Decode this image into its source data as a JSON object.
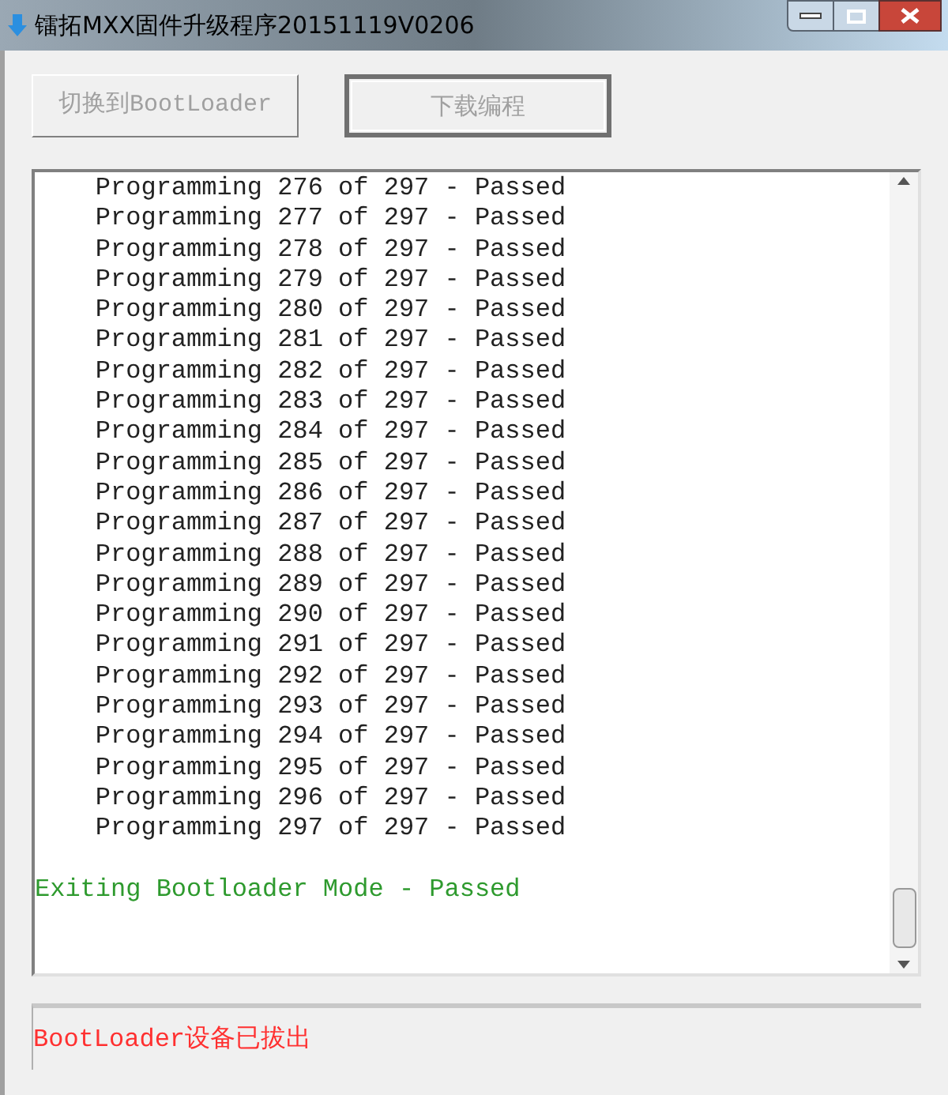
{
  "window": {
    "title": "镭拓MXX固件升级程序20151119V0206"
  },
  "buttons": [
    {
      "label": "切换到BootLoader",
      "disabled": true,
      "default": false
    },
    {
      "label": "下载编程",
      "disabled": true,
      "default": true
    }
  ],
  "log": [
    {
      "text": "    Programming 276 of 297 - Passed",
      "kind": "progress"
    },
    {
      "text": "    Programming 277 of 297 - Passed",
      "kind": "progress"
    },
    {
      "text": "    Programming 278 of 297 - Passed",
      "kind": "progress"
    },
    {
      "text": "    Programming 279 of 297 - Passed",
      "kind": "progress"
    },
    {
      "text": "    Programming 280 of 297 - Passed",
      "kind": "progress"
    },
    {
      "text": "    Programming 281 of 297 - Passed",
      "kind": "progress"
    },
    {
      "text": "    Programming 282 of 297 - Passed",
      "kind": "progress"
    },
    {
      "text": "    Programming 283 of 297 - Passed",
      "kind": "progress"
    },
    {
      "text": "    Programming 284 of 297 - Passed",
      "kind": "progress"
    },
    {
      "text": "    Programming 285 of 297 - Passed",
      "kind": "progress"
    },
    {
      "text": "    Programming 286 of 297 - Passed",
      "kind": "progress"
    },
    {
      "text": "    Programming 287 of 297 - Passed",
      "kind": "progress"
    },
    {
      "text": "    Programming 288 of 297 - Passed",
      "kind": "progress"
    },
    {
      "text": "    Programming 289 of 297 - Passed",
      "kind": "progress"
    },
    {
      "text": "    Programming 290 of 297 - Passed",
      "kind": "progress"
    },
    {
      "text": "    Programming 291 of 297 - Passed",
      "kind": "progress"
    },
    {
      "text": "    Programming 292 of 297 - Passed",
      "kind": "progress"
    },
    {
      "text": "    Programming 293 of 297 - Passed",
      "kind": "progress"
    },
    {
      "text": "    Programming 294 of 297 - Passed",
      "kind": "progress"
    },
    {
      "text": "    Programming 295 of 297 - Passed",
      "kind": "progress"
    },
    {
      "text": "    Programming 296 of 297 - Passed",
      "kind": "progress"
    },
    {
      "text": "    Programming 297 of 297 - Passed",
      "kind": "progress"
    },
    {
      "text": "Exiting Bootloader Mode - Passed",
      "kind": "success"
    }
  ],
  "status": {
    "text": "BootLoader设备已拔出"
  }
}
